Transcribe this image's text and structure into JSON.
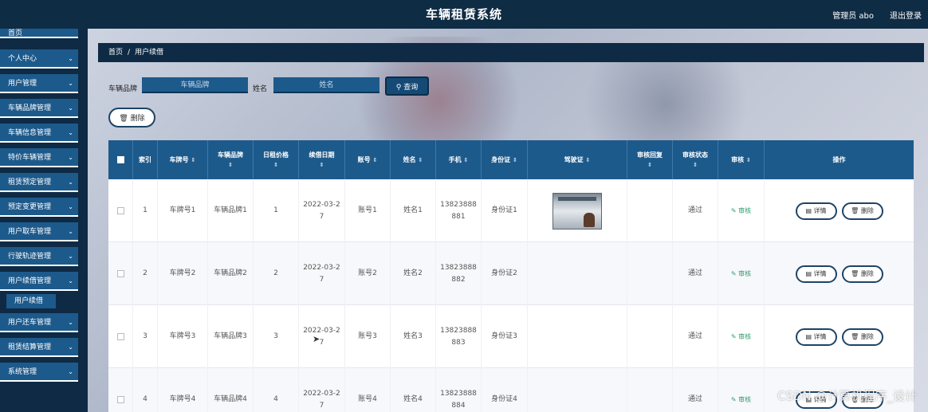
{
  "header": {
    "title": "车辆租赁系统",
    "user": "管理员 abo",
    "logout": "退出登录"
  },
  "sidebar": {
    "partial_top": "首页",
    "items": [
      {
        "label": "个人中心"
      },
      {
        "label": "用户管理"
      },
      {
        "label": "车辆品牌管理"
      },
      {
        "label": "车辆信息管理"
      },
      {
        "label": "特价车辆管理"
      },
      {
        "label": "租赁预定管理"
      },
      {
        "label": "预定变更管理"
      },
      {
        "label": "用户取车管理"
      },
      {
        "label": "行驶轨迹管理"
      },
      {
        "label": "用户续借管理"
      },
      {
        "label": "用户还车管理"
      },
      {
        "label": "租赁结算管理"
      },
      {
        "label": "系统管理"
      }
    ],
    "active_sub": "用户续借"
  },
  "breadcrumb": {
    "home": "首页",
    "sep": "/",
    "current": "用户续借"
  },
  "search": {
    "brand_label": "车辆品牌",
    "brand_placeholder": "车辆品牌",
    "name_label": "姓名",
    "name_placeholder": "姓名",
    "query_button": "查询"
  },
  "actions": {
    "delete_button": "删除"
  },
  "table": {
    "headers": [
      "索引",
      "车牌号",
      "车辆品牌",
      "日租价格",
      "续借日期",
      "账号",
      "姓名",
      "手机",
      "身份证",
      "驾驶证",
      "审核回复",
      "审核状态",
      "审核",
      "操作"
    ],
    "audit_link": "审核",
    "detail_button": "详情",
    "delete_button": "删除",
    "rows": [
      {
        "index": "1",
        "plate": "车牌号1",
        "brand": "车辆品牌1",
        "price": "1",
        "date1": "2022-03-2",
        "date2": "7",
        "account": "账号1",
        "name": "姓名1",
        "phone1": "13823888",
        "phone2": "881",
        "idcard": "身份证1",
        "reply": "",
        "status": "通过"
      },
      {
        "index": "2",
        "plate": "车牌号2",
        "brand": "车辆品牌2",
        "price": "2",
        "date1": "2022-03-2",
        "date2": "7",
        "account": "账号2",
        "name": "姓名2",
        "phone1": "13823888",
        "phone2": "882",
        "idcard": "身份证2",
        "reply": "",
        "status": "通过"
      },
      {
        "index": "3",
        "plate": "车牌号3",
        "brand": "车辆品牌3",
        "price": "3",
        "date1": "2022-03-2",
        "date2": "7",
        "account": "账号3",
        "name": "姓名3",
        "phone1": "13823888",
        "phone2": "883",
        "idcard": "身份证3",
        "reply": "",
        "status": "通过"
      },
      {
        "index": "4",
        "plate": "车牌号4",
        "brand": "车辆品牌4",
        "price": "4",
        "date1": "2022-03-2",
        "date2": "7",
        "account": "账号4",
        "name": "姓名4",
        "phone1": "13823888",
        "phone2": "884",
        "idcard": "身份证4",
        "reply": "",
        "status": "通过"
      }
    ]
  },
  "watermark": "CSDN @计算机程序_设计"
}
